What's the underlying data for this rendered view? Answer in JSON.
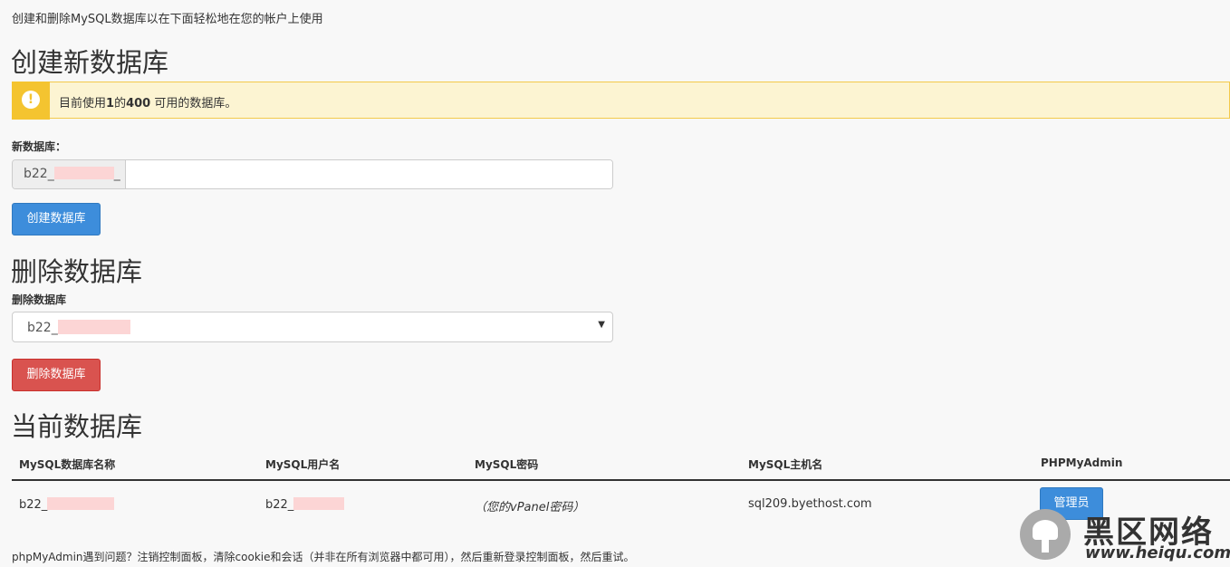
{
  "intro": "创建和删除MySQL数据库以在下面轻松地在您的帐户上使用",
  "create": {
    "heading": "创建新数据库",
    "alert_prefix": "目前使用",
    "alert_used": "1",
    "alert_mid": "的",
    "alert_total": "400",
    "alert_suffix": " 可用的数据库。",
    "label": "新数据库：",
    "prefix_start": "b22_",
    "prefix_end": "_",
    "input_value": "",
    "button": "创建数据库"
  },
  "delete": {
    "heading": "删除数据库",
    "label": "删除数据库",
    "selected_prefix": "b22_",
    "button": "删除数据库"
  },
  "current": {
    "heading": "当前数据库",
    "columns": [
      "MySQL数据库名称",
      "MySQL用户名",
      "MySQL密码",
      "MySQL主机名",
      "PHPMyAdmin"
    ],
    "row": {
      "db_prefix": "b22_",
      "user_prefix": "b22_",
      "password": "（您的vPanel密码）",
      "host": "sql209.byethost.com",
      "admin_button": "管理员"
    }
  },
  "footer": "phpMyAdmin遇到问题？注销控制面板，清除cookie和会话（并非在所有浏览器中都可用），然后重新登录控制面板，然后重试。",
  "watermark": {
    "cn": "黑区网络",
    "url": "www.heiqu.com"
  },
  "colors": {
    "primary": "#3d8ddb",
    "danger": "#d9534f",
    "warning": "#f4c430",
    "redacted": "#fcd5d5"
  }
}
